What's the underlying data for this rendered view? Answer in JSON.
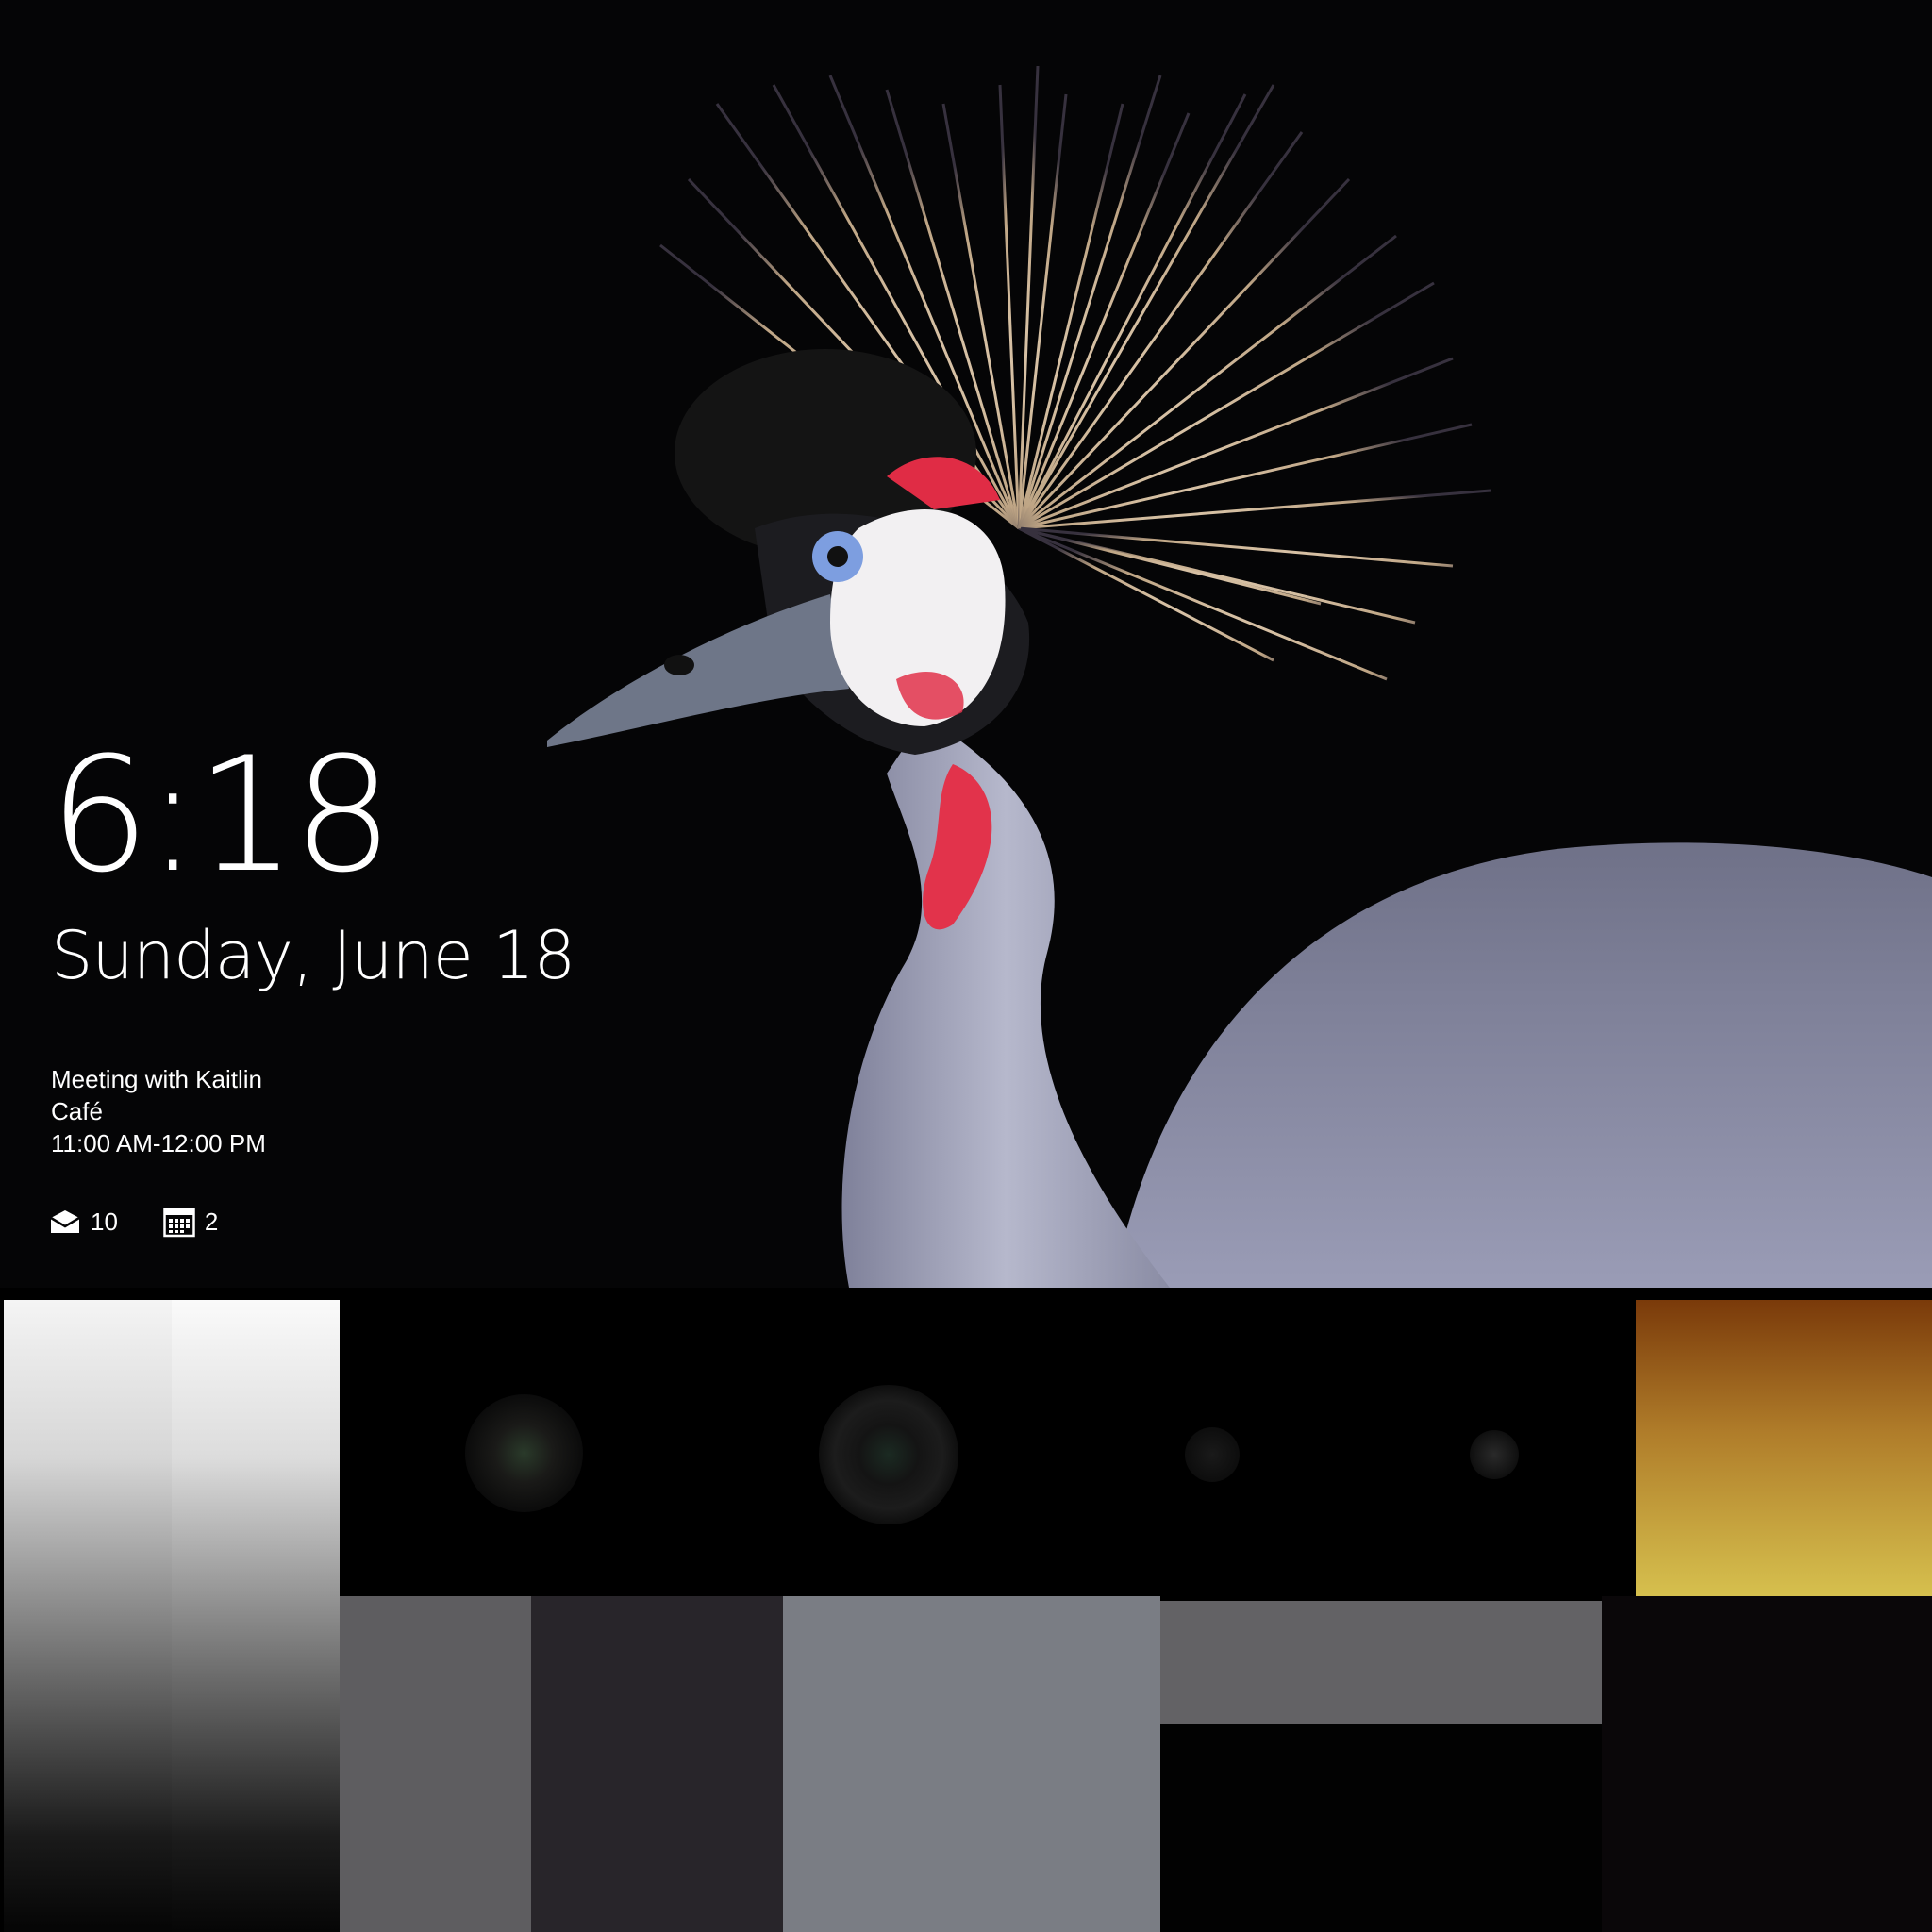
{
  "lock_screen": {
    "time": "6:18",
    "date": "Sunday, June 18",
    "event": {
      "title": "Meeting with Kaitlin",
      "location": "Café",
      "time_range": "11:00 AM-12:00 PM"
    },
    "badges": {
      "mail_icon": "mail-icon",
      "mail_count": "10",
      "calendar_icon": "calendar-icon",
      "calendar_count": "2"
    }
  },
  "palette": {
    "background": "#050506",
    "crest": "#e8d2b4",
    "wattle_red": "#e2334b",
    "body_grey": "#9496b0",
    "gold_top": "#7a3a0a",
    "gold_bottom": "#d6c04e"
  }
}
